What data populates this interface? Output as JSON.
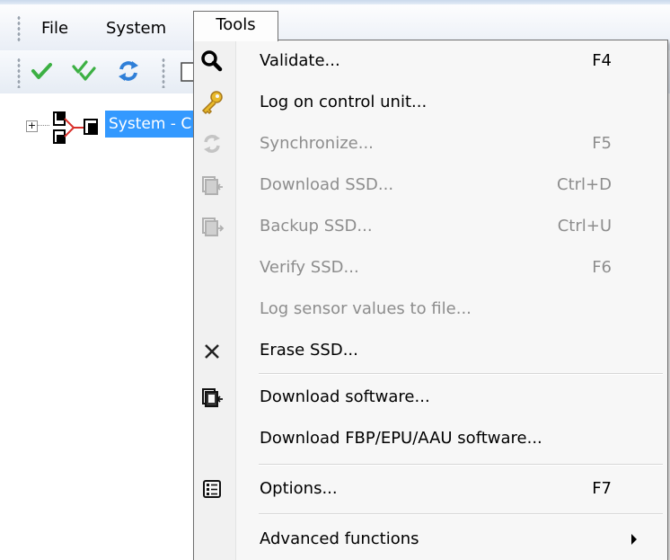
{
  "menubar": {
    "file": "File",
    "system": "System",
    "tools": "Tools"
  },
  "toolbar": {
    "buttons": [
      "check-icon",
      "double-check-icon",
      "sync-icon",
      "document-icon"
    ]
  },
  "tree": {
    "selected_label": "System - C",
    "expander": "+"
  },
  "tools_menu": {
    "items": [
      {
        "label": "Validate...",
        "shortcut": "F4",
        "icon": "magnifier-icon",
        "enabled": true
      },
      {
        "label": "Log on control unit...",
        "shortcut": "",
        "icon": "key-icon",
        "enabled": true
      },
      {
        "label": "Synchronize...",
        "shortcut": "F5",
        "icon": "sync-icon",
        "enabled": false
      },
      {
        "label": "Download SSD...",
        "shortcut": "Ctrl+D",
        "icon": "download-ssd-icon",
        "enabled": false
      },
      {
        "label": "Backup SSD...",
        "shortcut": "Ctrl+U",
        "icon": "backup-ssd-icon",
        "enabled": false
      },
      {
        "label": "Verify SSD...",
        "shortcut": "F6",
        "icon": "",
        "enabled": false
      },
      {
        "label": "Log sensor values to file...",
        "shortcut": "",
        "icon": "",
        "enabled": false
      },
      {
        "label": "Erase SSD...",
        "shortcut": "",
        "icon": "erase-icon",
        "enabled": true
      },
      {
        "label": "Download software...",
        "shortcut": "",
        "icon": "download-software-icon",
        "enabled": true
      },
      {
        "label": "Download FBP/EPU/AAU software...",
        "shortcut": "",
        "icon": "",
        "enabled": true
      },
      {
        "label": "Options...",
        "shortcut": "F7",
        "icon": "options-icon",
        "enabled": true
      },
      {
        "label": "Advanced functions",
        "shortcut": "",
        "icon": "",
        "enabled": true,
        "submenu": true
      }
    ]
  },
  "colors": {
    "selection": "#3399ff",
    "disabled_text": "#8d8d8d",
    "check_green": "#3cb043",
    "key_gold": "#d9a520"
  }
}
